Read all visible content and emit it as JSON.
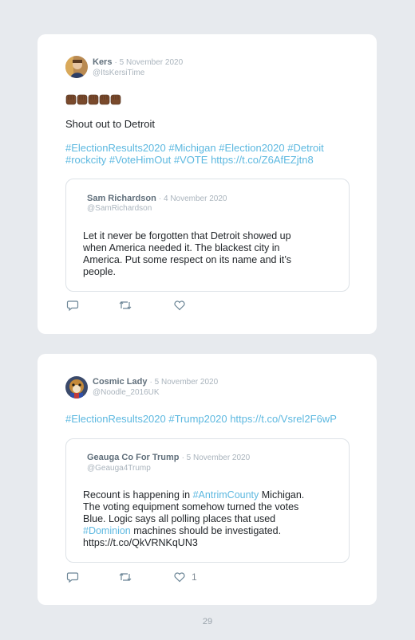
{
  "tweets": [
    {
      "author_name": "Kers",
      "date": "· 5 November 2020",
      "handle": "@ItsKersiTime",
      "emoji_count": 5,
      "body_line1": "Shout out to Detroit",
      "hashtags_line1": "#ElectionResults2020 #Michigan #Election2020 #Detroit",
      "hashtags_line2": "#rockcity #VoteHimOut #VOTE https://t.co/Z6AfEZjtn8",
      "quoted": {
        "author_name": "Sam Richardson",
        "date": "· 4 November 2020",
        "handle": "@SamRichardson",
        "lines": [
          "Let it never be forgotten that Detroit showed up",
          "when America needed it. The blackest city in",
          "America. Put some respect on its name and it’s",
          "people."
        ]
      },
      "like_count": ""
    },
    {
      "author_name": "Cosmic Lady",
      "date": "· 5 November 2020",
      "handle": "@Noodle_2016UK",
      "hashtags_line1": "#ElectionResults2020 #Trump2020 https://t.co/Vsrel2F6wP",
      "quoted": {
        "author_name": "Geauga Co For Trump",
        "date": "· 5 November 2020",
        "handle": "@Geauga4Trump",
        "line1_pre": "Recount is happening in ",
        "line1_link": "#AntrimCounty",
        "line1_post": " Michigan.",
        "line2": "The voting equipment somehow turned the votes",
        "line3": "Blue. Logic says all polling places that used",
        "line4_link": "#Dominion",
        "line4_post": " machines should be investigated.",
        "line5_link": "https://t.co/QkVRNKqUN3"
      },
      "like_count": "1"
    }
  ],
  "icons": {
    "reply": "reply-icon",
    "retweet": "retweet-icon",
    "like": "heart-icon",
    "emoji": "raised-fist-emoji"
  },
  "colors": {
    "link": "#5cb8e0",
    "background": "#e7eaee",
    "card": "#ffffff"
  },
  "page_number": "29"
}
